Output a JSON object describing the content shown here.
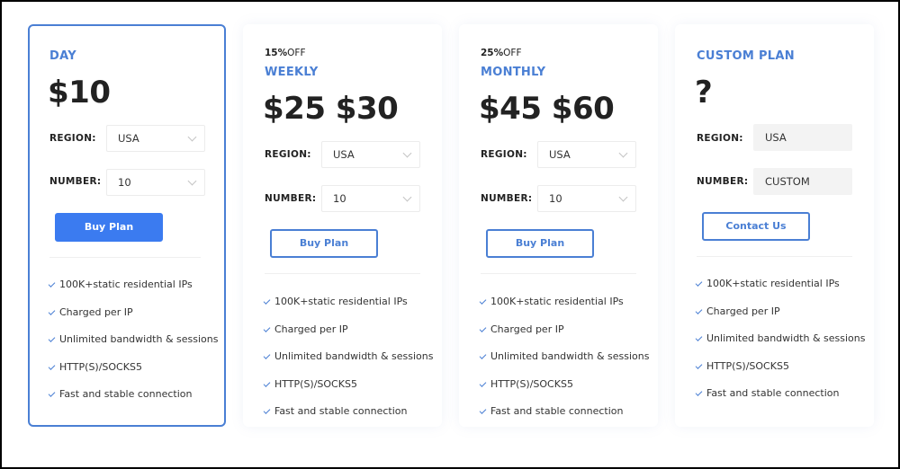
{
  "colors": {
    "accent": "#4a7fd4",
    "primary_button": "#3b7bf0",
    "text": "#222222",
    "readonly_field": "#f3f3f3"
  },
  "plans": [
    {
      "discount_value": "",
      "discount_suffix": "",
      "name": "DAY",
      "price": "$10",
      "region_label": "REGION:",
      "region_value": "USA",
      "number_label": "NUMBER:",
      "number_value": "10",
      "button_label": "Buy Plan",
      "selected": true,
      "features": [
        "100K+static residential IPs",
        "Charged per IP",
        "Unlimited bandwidth & sessions",
        "HTTP(S)/SOCKS5",
        "Fast and stable connection"
      ]
    },
    {
      "discount_value": "15%",
      "discount_suffix": "OFF",
      "name": "WEEKLY",
      "price": "$25 $30",
      "region_label": "REGION:",
      "region_value": "USA",
      "number_label": "NUMBER:",
      "number_value": "10",
      "button_label": "Buy Plan",
      "selected": false,
      "features": [
        "100K+static residential IPs",
        "Charged per IP",
        "Unlimited bandwidth & sessions",
        "HTTP(S)/SOCKS5",
        "Fast and stable connection"
      ]
    },
    {
      "discount_value": "25%",
      "discount_suffix": "OFF",
      "name": "MONTHLY",
      "price": "$45 $60",
      "region_label": "REGION:",
      "region_value": "USA",
      "number_label": "NUMBER:",
      "number_value": "10",
      "button_label": "Buy Plan",
      "selected": false,
      "features": [
        "100K+static residential IPs",
        "Charged per IP",
        "Unlimited bandwidth & sessions",
        "HTTP(S)/SOCKS5",
        "Fast and stable connection"
      ]
    },
    {
      "discount_value": "",
      "discount_suffix": "",
      "name": "CUSTOM PLAN",
      "price": "?",
      "region_label": "REGION:",
      "region_value": "USA",
      "number_label": "NUMBER:",
      "number_value": "CUSTOM",
      "button_label": "Contact Us",
      "selected": false,
      "features": [
        "100K+static residential IPs",
        "Charged per IP",
        "Unlimited bandwidth & sessions",
        "HTTP(S)/SOCKS5",
        "Fast and stable connection"
      ]
    }
  ]
}
